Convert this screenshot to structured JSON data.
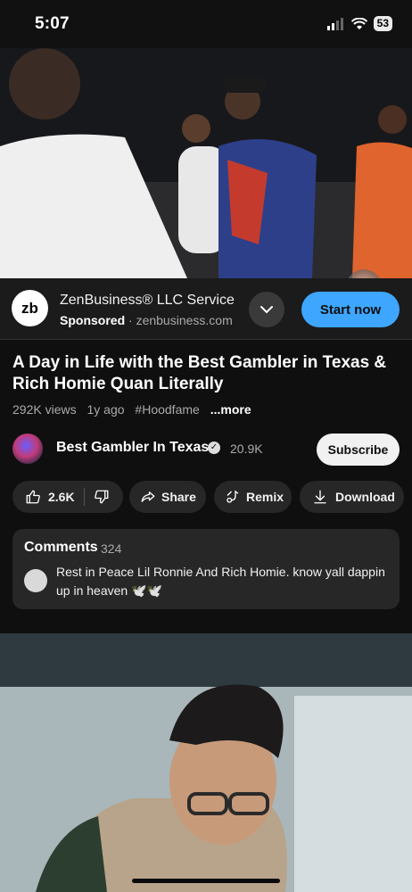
{
  "status_bar": {
    "time": "5:07",
    "battery": "53"
  },
  "ad": {
    "logo_text": "zb",
    "title": "ZenBusiness® LLC Service",
    "sponsored_label": "Sponsored",
    "separator": " · ",
    "domain": "zenbusiness.com",
    "cta_label": "Start now"
  },
  "video": {
    "title": "A Day in Life with the Best Gambler in Texas & Rich Homie Quan Literally",
    "views": "292K views",
    "age": "1y ago",
    "hashtag": "#Hoodfame",
    "more_label": "...more"
  },
  "channel": {
    "name": "Best Gambler In Texas",
    "subscribers": "20.9K",
    "subscribe_label": "Subscribe"
  },
  "actions": {
    "like_count": "2.6K",
    "share_label": "Share",
    "remix_label": "Remix",
    "download_label": "Download"
  },
  "comments": {
    "title": "Comments",
    "count": "324",
    "top_comment": "Rest in Peace Lil Ronnie And Rich Homie. know yall dappin up in heaven 🕊️🕊️"
  },
  "colors": {
    "accent": "#3ea6ff",
    "background": "#0f0f0f",
    "pill": "#272727"
  }
}
